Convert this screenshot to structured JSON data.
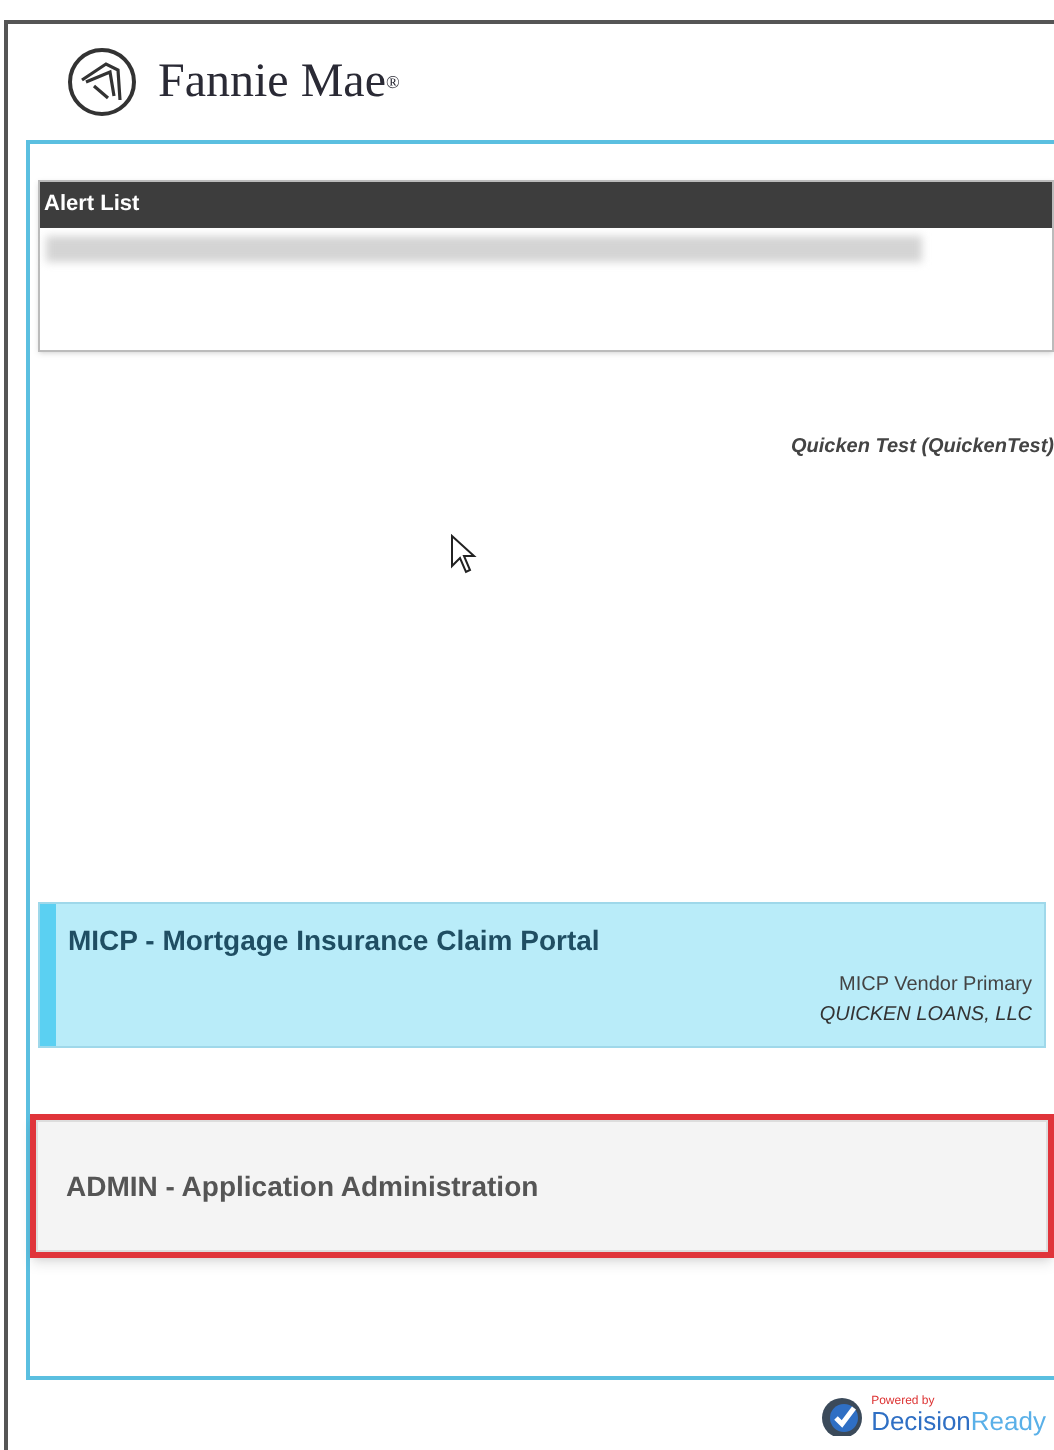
{
  "brand": {
    "name": "Fannie Mae",
    "mark": "®"
  },
  "alert_list": {
    "title": "Alert List",
    "redacted": true
  },
  "user": "Quicken Test (QuickenTest)",
  "apps": [
    {
      "title": "MICP - Mortgage Insurance Claim Portal",
      "role": "MICP Vendor Primary",
      "org": "QUICKEN LOANS, LLC",
      "kind": "active",
      "highlighted": false
    },
    {
      "title": "ADMIN - Application Administration",
      "kind": "plain",
      "highlighted": true
    }
  ],
  "footer": {
    "powered": "Powered by",
    "product_a": "Decision",
    "product_b": "Ready"
  }
}
